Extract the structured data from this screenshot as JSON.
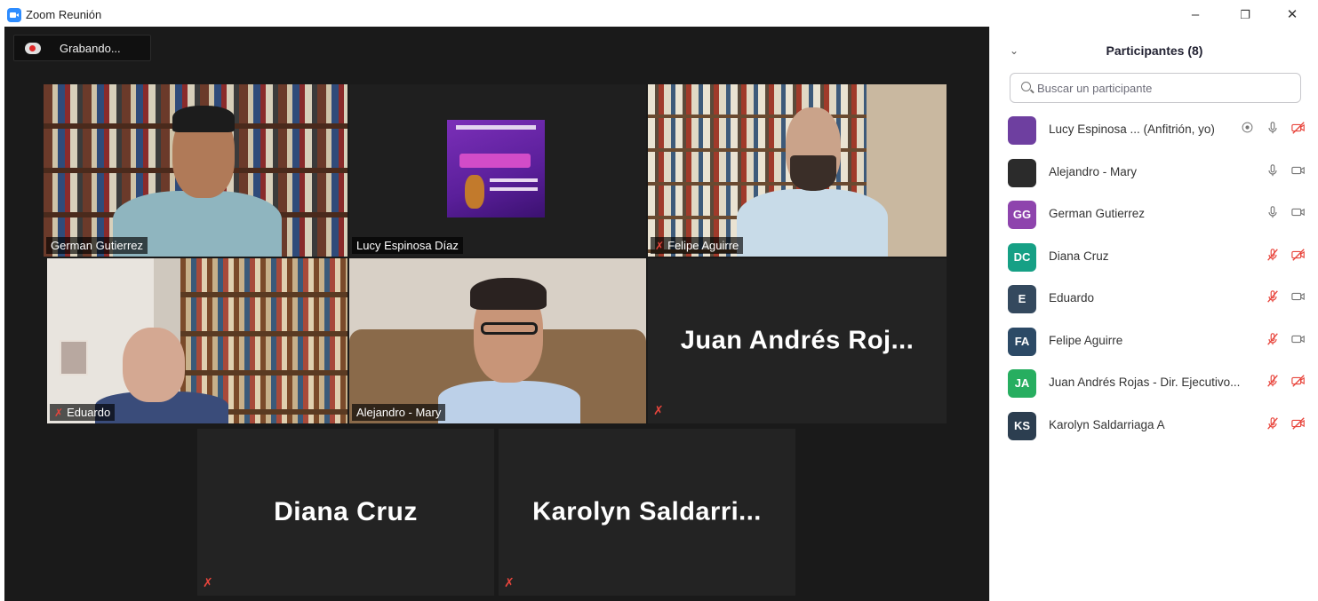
{
  "window": {
    "title": "Zoom Reunión"
  },
  "recording": {
    "label": "Grabando..."
  },
  "tiles": [
    {
      "name": "German Gutierrez",
      "muted": false,
      "video": true
    },
    {
      "name": "Lucy Espinosa Díaz",
      "muted": false,
      "video": true
    },
    {
      "name": "Felipe Aguirre",
      "muted": true,
      "video": true
    },
    {
      "name": "Eduardo",
      "muted": true,
      "video": true
    },
    {
      "name": "Alejandro - Mary",
      "muted": false,
      "video": true
    },
    {
      "name": "Juan  Andrés  Roj...",
      "muted": true,
      "video": false
    },
    {
      "name": "Diana Cruz",
      "muted": true,
      "video": false
    },
    {
      "name": "Karolyn  Saldarri...",
      "muted": true,
      "video": false
    }
  ],
  "panel": {
    "title": "Participantes (8)",
    "search_placeholder": "Buscar un participante",
    "participants": [
      {
        "name": "Lucy Espinosa ...  (Anfitrión, yo)",
        "initials": "",
        "avatar_color": "#6e3fa0",
        "mic": "on",
        "video": "off",
        "recording": true
      },
      {
        "name": "Alejandro - Mary",
        "initials": "",
        "avatar_color": "#2b2b2b",
        "mic": "on",
        "video": "on"
      },
      {
        "name": "German Gutierrez",
        "initials": "GG",
        "avatar_color": "#8e44ad",
        "mic": "on",
        "video": "on"
      },
      {
        "name": "Diana Cruz",
        "initials": "DC",
        "avatar_color": "#16a085",
        "mic": "off",
        "video": "off"
      },
      {
        "name": "Eduardo",
        "initials": "E",
        "avatar_color": "#34495e",
        "mic": "off",
        "video": "on"
      },
      {
        "name": "Felipe Aguirre",
        "initials": "FA",
        "avatar_color": "#2c4a66",
        "mic": "off",
        "video": "on"
      },
      {
        "name": "Juan Andrés Rojas - Dir. Ejecutivo...",
        "initials": "JA",
        "avatar_color": "#27ae60",
        "mic": "off",
        "video": "off"
      },
      {
        "name": "Karolyn Saldarriaga A",
        "initials": "KS",
        "avatar_color": "#2c3e50",
        "mic": "off",
        "video": "off"
      }
    ]
  }
}
